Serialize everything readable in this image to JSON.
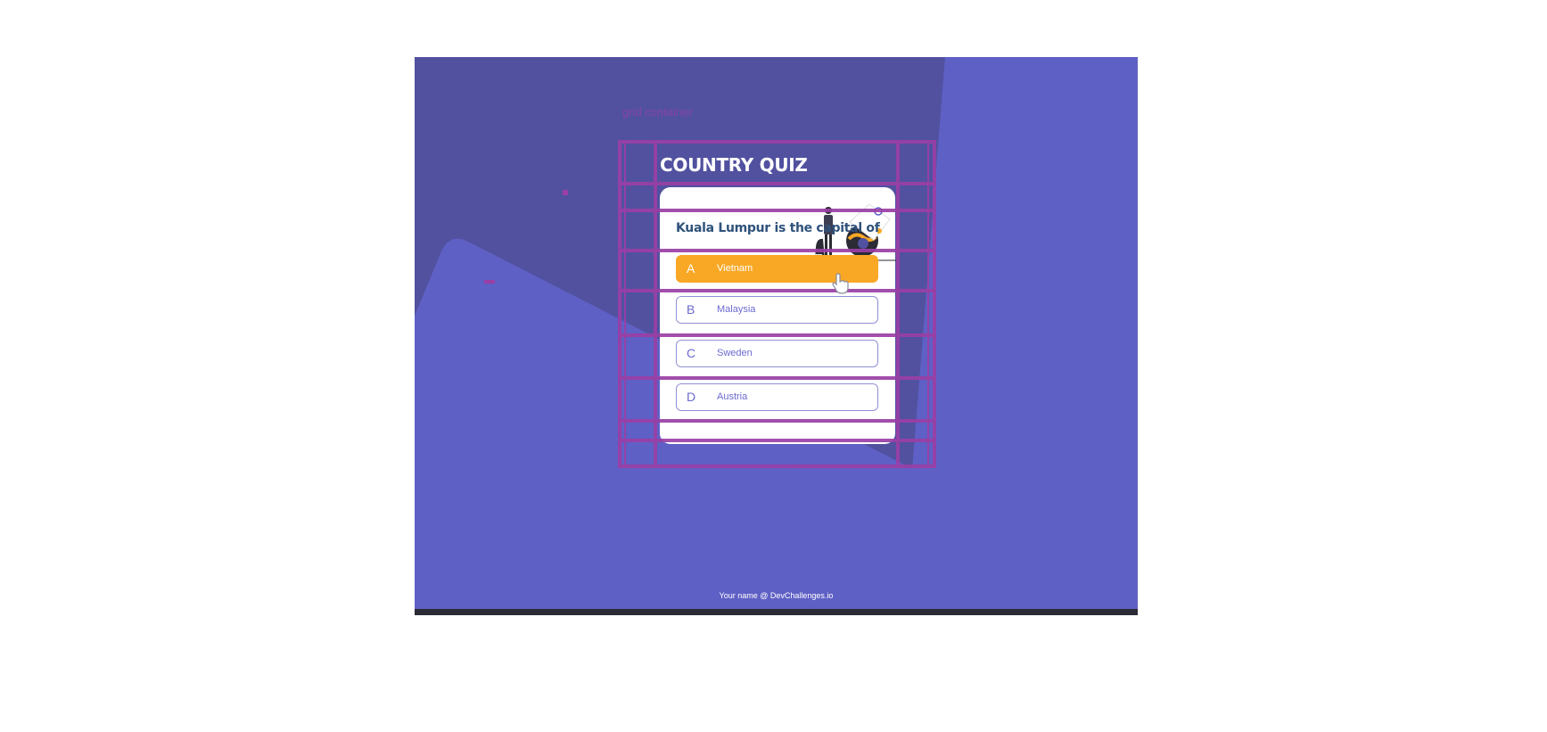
{
  "overlay": {
    "grid_label": "grid container"
  },
  "quiz": {
    "title": "COUNTRY QUIZ",
    "question": "Kuala Lumpur is the capital of",
    "options": [
      {
        "letter": "A",
        "text": "Vietnam",
        "selected": true
      },
      {
        "letter": "B",
        "text": "Malaysia",
        "selected": false
      },
      {
        "letter": "C",
        "text": "Sweden",
        "selected": false
      },
      {
        "letter": "D",
        "text": "Austria",
        "selected": false
      }
    ]
  },
  "footer": {
    "credit": "Your name @ DevChallenges.io"
  },
  "colors": {
    "background_dark": "#5151a0",
    "background_light": "#5f60c5",
    "accent_selected": "#f9a826",
    "question_text": "#2f527b",
    "option_text": "#6a6ad0",
    "grid_overlay": "#9a3fa6"
  },
  "icons": {
    "illustration": "traveler-with-globe-illustration",
    "cursor": "hand-pointer-cursor-icon"
  }
}
